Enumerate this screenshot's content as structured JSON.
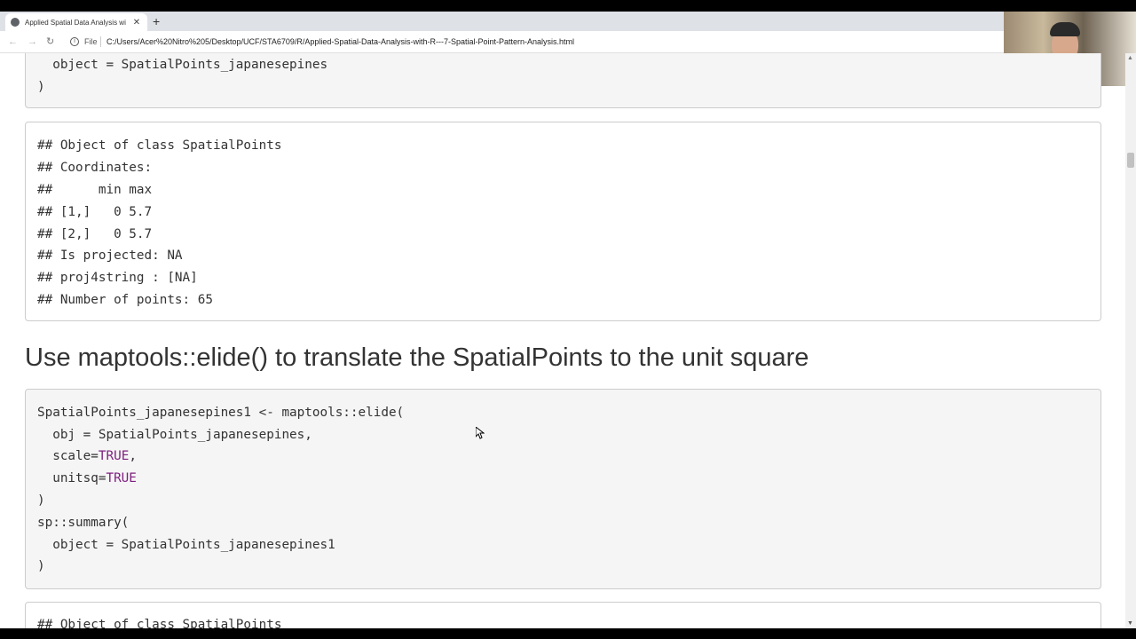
{
  "browser": {
    "tab_title": "Applied Spatial Data Analysis wi",
    "tab_close": "✕",
    "new_tab": "+",
    "back": "←",
    "forward": "→",
    "reload": "↻",
    "info": "i",
    "file_label": "File",
    "url": "C:/Users/Acer%20Nitro%205/Desktop/UCF/STA6709/R/Applied-Spatial-Data-Analysis-with-R---7-Spatial-Point-Pattern-Analysis.html"
  },
  "blocks": {
    "code1": {
      "lines": [
        "  object = SpatialPoints_japanesepines",
        ")"
      ]
    },
    "output1": {
      "lines": [
        "## Object of class SpatialPoints",
        "## Coordinates:",
        "##      min max",
        "## [1,]   0 5.7",
        "## [2,]   0 5.7",
        "## Is projected: NA",
        "## proj4string : [NA]",
        "## Number of points: 65"
      ]
    },
    "heading": "Use maptools::elide() to translate the SpatialPoints to the unit square",
    "code2": {
      "line1": "SpatialPoints_japanesepines1 <- maptools::elide(",
      "line2": "  obj = SpatialPoints_japanesepines,",
      "line3_pre": "  scale=",
      "line3_kw": "TRUE",
      "line3_post": ",",
      "line4_pre": "  unitsq=",
      "line4_kw": "TRUE",
      "line5": ")",
      "line6": "sp::summary(",
      "line7": "  object = SpatialPoints_japanesepines1",
      "line8": ")"
    },
    "output2": {
      "line1": "## Object of class SpatialPoints"
    }
  },
  "scrollbar": {
    "up": "▲",
    "down": "▼"
  }
}
